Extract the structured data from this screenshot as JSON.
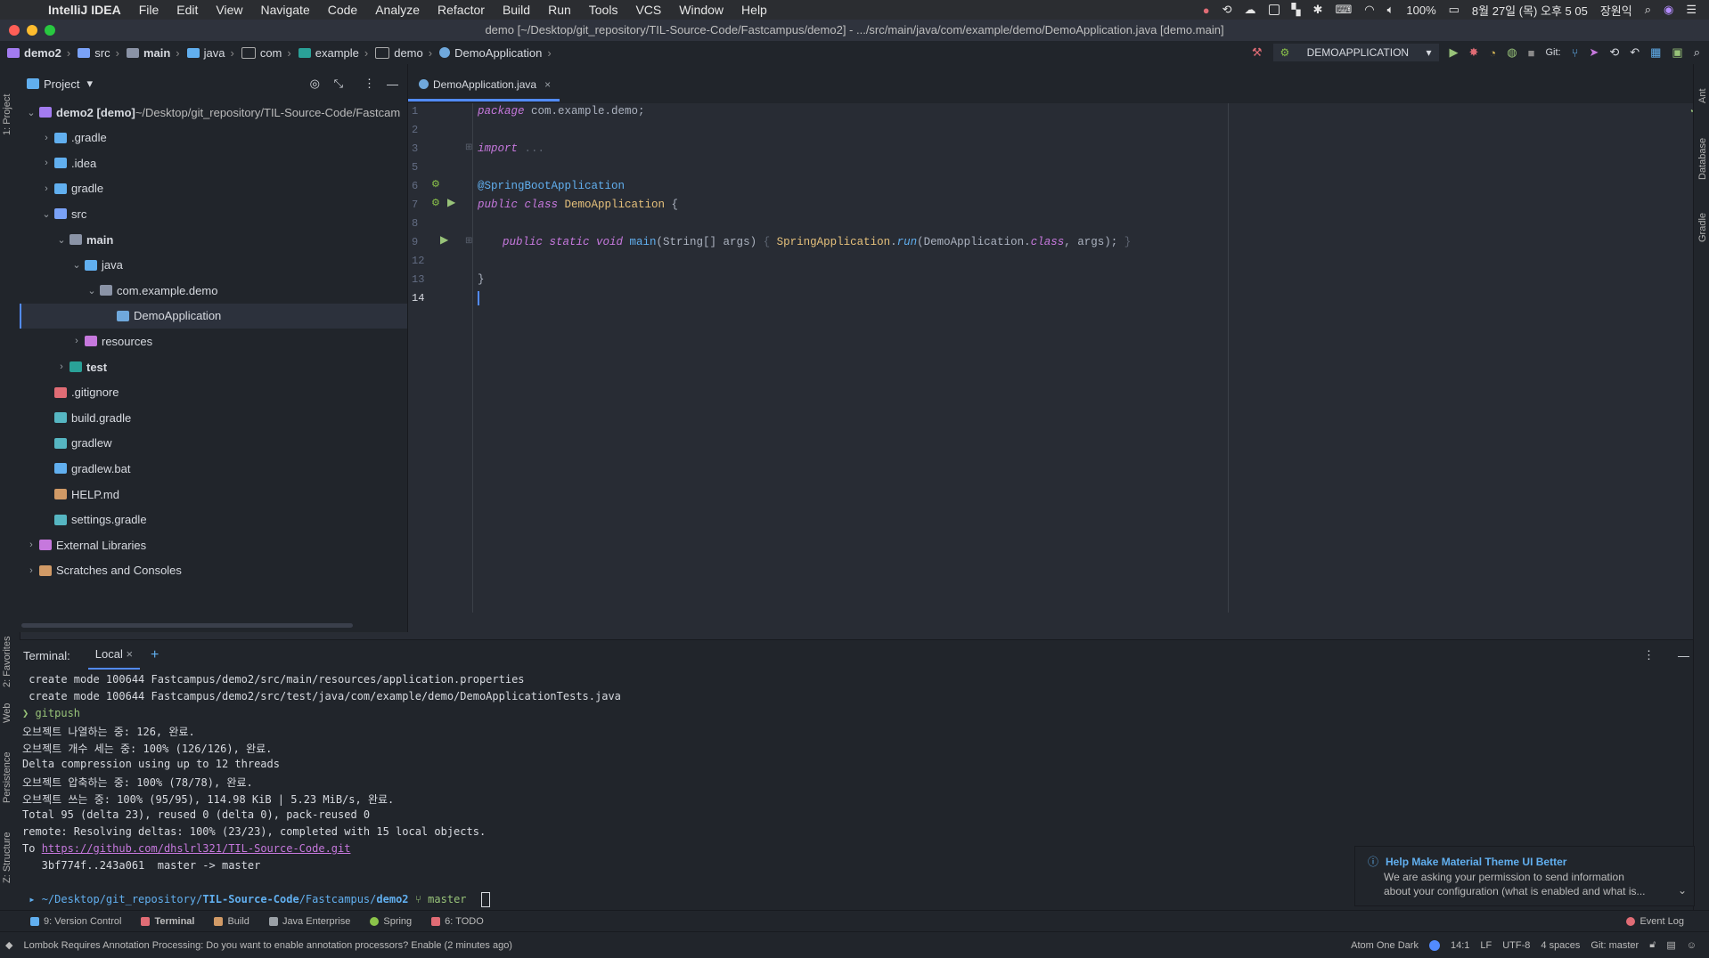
{
  "menubar": {
    "app": "IntelliJ IDEA",
    "items": [
      "File",
      "Edit",
      "View",
      "Navigate",
      "Code",
      "Analyze",
      "Refactor",
      "Build",
      "Run",
      "Tools",
      "VCS",
      "Window",
      "Help"
    ],
    "battery": "100%",
    "datetime": "8월 27일 (목) 오후 5 05",
    "user": "장원익"
  },
  "titlebar": {
    "title": "demo [~/Desktop/git_repository/TIL-Source-Code/Fastcampus/demo2] - .../src/main/java/com/example/demo/DemoApplication.java [demo.main]"
  },
  "breadcrumbs": [
    "demo2",
    "src",
    "main",
    "java",
    "com",
    "example",
    "demo",
    "DemoApplication"
  ],
  "navbar": {
    "run_config": "DEMOAPPLICATION",
    "git_label": "Git:"
  },
  "project": {
    "header": "Project",
    "tree": [
      {
        "label": "demo2 [demo]",
        "extra": "~/Desktop/git_repository/TIL-Source-Code/Fastcam",
        "depth": 0,
        "chev": "⌄"
      },
      {
        "label": ".gradle",
        "depth": 1,
        "chev": "›"
      },
      {
        "label": ".idea",
        "depth": 1,
        "chev": "›"
      },
      {
        "label": "gradle",
        "depth": 1,
        "chev": "›"
      },
      {
        "label": "src",
        "depth": 1,
        "chev": "⌄"
      },
      {
        "label": "main",
        "depth": 2,
        "chev": "⌄"
      },
      {
        "label": "java",
        "depth": 3,
        "chev": "⌄"
      },
      {
        "label": "com.example.demo",
        "depth": 4,
        "chev": "⌄"
      },
      {
        "label": "DemoApplication",
        "depth": 5,
        "chev": ""
      },
      {
        "label": "resources",
        "depth": 3,
        "chev": "›"
      },
      {
        "label": "test",
        "depth": 2,
        "chev": "›"
      },
      {
        "label": ".gitignore",
        "depth": 1,
        "chev": ""
      },
      {
        "label": "build.gradle",
        "depth": 1,
        "chev": ""
      },
      {
        "label": "gradlew",
        "depth": 1,
        "chev": ""
      },
      {
        "label": "gradlew.bat",
        "depth": 1,
        "chev": ""
      },
      {
        "label": "HELP.md",
        "depth": 1,
        "chev": ""
      },
      {
        "label": "settings.gradle",
        "depth": 1,
        "chev": ""
      },
      {
        "label": "External Libraries",
        "depth": 0,
        "chev": "›"
      },
      {
        "label": "Scratches and Consoles",
        "depth": 0,
        "chev": "›"
      }
    ]
  },
  "editor": {
    "tab": "DemoApplication.java",
    "line_numbers": [
      "1",
      "2",
      "3",
      "5",
      "6",
      "7",
      "8",
      "9",
      "12",
      "13",
      "14"
    ],
    "code": {
      "l1_kw": "package",
      "l1_rest": " com.example.demo;",
      "l3_kw": "import",
      "l3_rest": " ...",
      "l6": "@SpringBootApplication",
      "l7_kw": "public class",
      "l7_cls": " DemoApplication",
      "l7_rest": " {",
      "l9_kw": "public static void",
      "l9_fn": " main",
      "l9_a": "(String[] args) ",
      "l9_b": "{ ",
      "l9_c": "SpringApplication",
      "l9_d": ".",
      "l9_e": "run",
      "l9_f": "(DemoApplication.",
      "l9_g": "class",
      "l9_h": ", args); ",
      "l9_i": "}",
      "l13": "}"
    }
  },
  "terminal": {
    "label": "Terminal:",
    "tab": "Local",
    "lines": [
      " create mode 100644 Fastcampus/demo2/src/main/resources/application.properties",
      " create mode 100644 Fastcampus/demo2/src/test/java/com/example/demo/DemoApplicationTests.java",
      "❯ gitpush",
      "오브젝트 나열하는 중: 126, 완료.",
      "오브젝트 개수 세는 중: 100% (126/126), 완료.",
      "Delta compression using up to 12 threads",
      "오브젝트 압축하는 중: 100% (78/78), 완료.",
      "오브젝트 쓰는 중: 100% (95/95), 114.98 KiB | 5.23 MiB/s, 완료.",
      "Total 95 (delta 23), reused 0 (delta 0), pack-reused 0",
      "remote: Resolving deltas: 100% (23/23), completed with 15 local objects."
    ],
    "to_prefix": "To ",
    "to_link": "https://github.com/dhslrl321/TIL-Source-Code.git",
    "last_line": "   3bf774f..243a061  master -> master",
    "prompt_path_a": "~/Desktop/git_repository/",
    "prompt_path_b": "TIL-Source-Code",
    "prompt_path_c": "/Fastcampus/",
    "prompt_path_d": "demo2",
    "prompt_branch": "master"
  },
  "notification": {
    "title": "Help Make Material Theme UI Better",
    "body1": "We are asking your permission to send information",
    "body2": "about your configuration (what is enabled and what is..."
  },
  "tooltabs": [
    "9: Version Control",
    "Terminal",
    "Build",
    "Java Enterprise",
    "Spring",
    "6: TODO"
  ],
  "event_log": "Event Log",
  "sidebar_left": [
    "1: Project",
    "2: Favorites",
    "Web",
    "Persistence",
    "Z: Structure"
  ],
  "sidebar_right": [
    "Ant",
    "Database",
    "Gradle"
  ],
  "status": {
    "message": "Lombok Requires Annotation Processing: Do you want to enable annotation processors? Enable (2 minutes ago)",
    "theme": "Atom One Dark",
    "position": "14:1",
    "line_sep": "LF",
    "encoding": "UTF-8",
    "indent": "4 spaces",
    "git": "Git: master"
  }
}
